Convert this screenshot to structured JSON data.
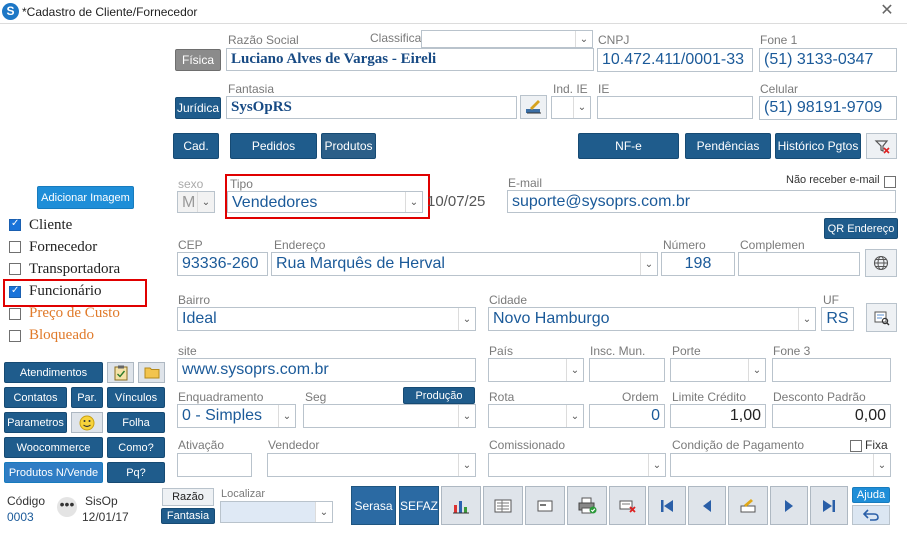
{
  "window": {
    "title": "*Cadastro de Cliente/Fornecedor",
    "app_icon": "S"
  },
  "labels": {
    "razao_social": "Razão Social",
    "classificacao": "Classificação",
    "cnpj": "CNPJ",
    "fone1": "Fone 1",
    "fantasia": "Fantasia",
    "ind_ie": "Ind. IE",
    "ie": "IE",
    "celular": "Celular",
    "sexo": "sexo",
    "tipo": "Tipo",
    "email": "E-mail",
    "nao_receber": "Não receber e-mail",
    "cep": "CEP",
    "endereco": "Endereço",
    "numero": "Número",
    "complemento": "Complemen",
    "bairro": "Bairro",
    "cidade": "Cidade",
    "uf": "UF",
    "site": "site",
    "pais": "País",
    "insc_mun": "Insc. Mun.",
    "porte": "Porte",
    "fone3": "Fone 3",
    "enquadramento": "Enquadramento",
    "seg": "Seg",
    "rota": "Rota",
    "ordem": "Ordem",
    "limite_credito": "Limite Crédito",
    "desconto_padrao": "Desconto Padrão",
    "ativacao": "Ativação",
    "vendedor": "Vendedor",
    "comissionado": "Comissionado",
    "condicao_pagamento": "Condição de Pagamento",
    "fixa": "Fixa",
    "codigo": "Código",
    "localizar": "Localizar"
  },
  "values": {
    "razao_social": "Luciano Alves de Vargas - Eireli",
    "cnpj": "10.472.411/0001-33",
    "fone1": "(51) 3133-0347",
    "fantasia": "SysOpRS",
    "celular": "(51) 98191-9709",
    "sexo": "M",
    "tipo": "Vendedores",
    "date": "10/07/25",
    "email": "suporte@sysoprs.com.br",
    "cep": "93336-260",
    "endereco": "Rua Marquês de Herval",
    "numero": "198",
    "bairro": "Ideal",
    "cidade": "Novo Hamburgo",
    "uf": "RS",
    "site": "www.sysoprs.com.br",
    "enquadramento": "0 - Simples",
    "ordem": "0",
    "limite_credito": "1,00",
    "desconto_padrao": "0,00",
    "codigo": "0003",
    "user": "SisOp",
    "user_date": "12/01/17"
  },
  "buttons": {
    "fisica": "Física",
    "juridica": "Jurídica",
    "cad": "Cad.",
    "pedidos": "Pedidos",
    "produtos": "Produtos",
    "nfe": "NF-e",
    "pendencias": "Pendências",
    "historico": "Histórico Pgtos",
    "qr_endereco": "QR Endereço",
    "producao": "Produção",
    "adicionar_imagem": "Adicionar Imagem",
    "atendimentos": "Atendimentos",
    "contatos": "Contatos",
    "par": "Par.",
    "vinculos": "Vínculos",
    "parametros": "Parametros",
    "folha": "Folha",
    "woocommerce": "Woocommerce",
    "como": "Como?",
    "produtos_nvende": "Produtos N/Vende",
    "pq": "Pq?",
    "razao": "Razão",
    "fantasia_btn": "Fantasia",
    "serasa": "Serasa",
    "sefaz": "SEFAZ",
    "ajuda": "Ajuda"
  },
  "checks": [
    {
      "label": "Cliente",
      "checked": true
    },
    {
      "label": "Fornecedor",
      "checked": false
    },
    {
      "label": "Transportadora",
      "checked": false
    },
    {
      "label": "Funcionário",
      "checked": true
    },
    {
      "label": "Preço de Custo",
      "checked": false
    },
    {
      "label": "Bloqueado",
      "checked": false
    }
  ],
  "colors": {
    "accent": "#1f5c8c",
    "highlight": "#e00000",
    "link": "#1b5a99"
  }
}
